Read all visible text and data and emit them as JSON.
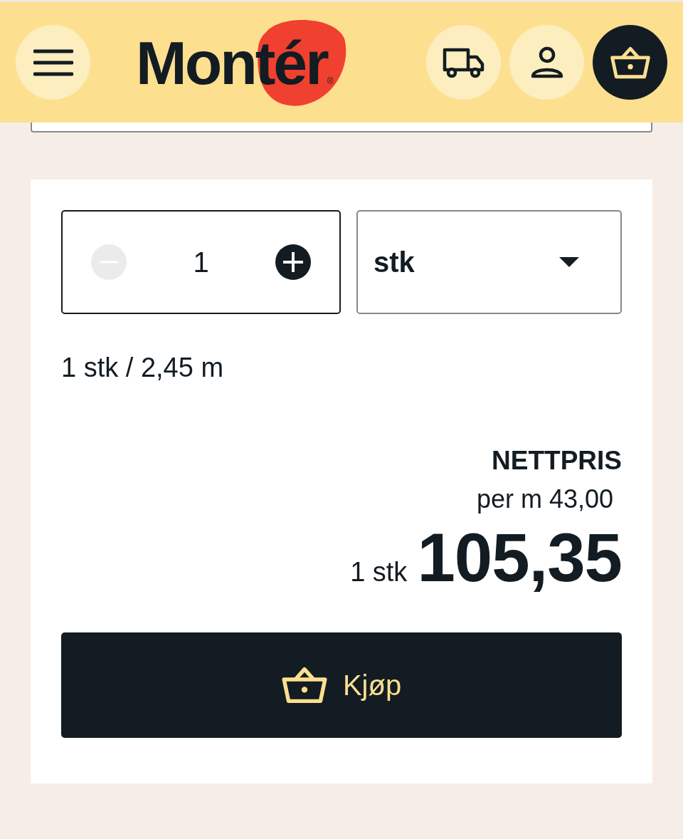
{
  "header": {
    "logo": "Montér",
    "logo_mark": "®"
  },
  "quantity": {
    "value": "1",
    "decrease_disabled": true
  },
  "unit_select": {
    "value": "stk"
  },
  "conversion": "1 stk / 2,45 m",
  "price": {
    "label": "NETTPRIS",
    "unit_price": "per m 43,00",
    "quantity_label": "1 stk",
    "amount": "105,35"
  },
  "buy_button": {
    "label": "Kjøp"
  }
}
